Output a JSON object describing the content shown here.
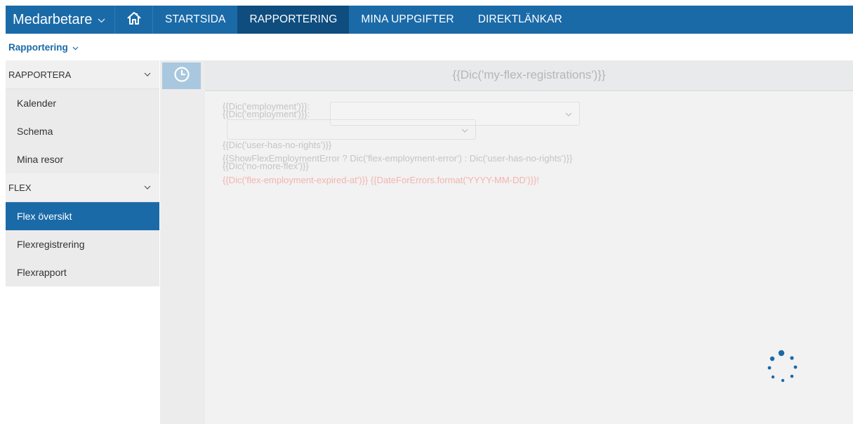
{
  "topbar": {
    "app_switcher": "Medarbetare",
    "nav": [
      {
        "label": "STARTSIDA",
        "active": false
      },
      {
        "label": "RAPPORTERING",
        "active": true
      },
      {
        "label": "MINA UPPGIFTER",
        "active": false
      },
      {
        "label": "DIREKTLÄNKAR",
        "active": false
      }
    ],
    "color": "#1a6aa8",
    "active_color": "#0f4d7e"
  },
  "subbar": {
    "breadcrumb": "Rapportering"
  },
  "sidebar": {
    "sections": [
      {
        "label": "RAPPORTERA",
        "items": [
          "Kalender",
          "Schema",
          "Mina resor"
        ]
      },
      {
        "label": "FLEX",
        "items": [
          "Flex översikt",
          "Flexregistrering",
          "Flexrapport"
        ]
      }
    ],
    "active_item": "Flex översikt"
  },
  "main": {
    "title": "{{Dic('my-flex-registrations')}}",
    "employment_label_1": "{{Dic('employment')}}:",
    "employment_label_2": "{{Dic('employment')}}:",
    "no_rights": "{{Dic('user-has-no-rights')}}",
    "error_line": "{{ShowFlexEmploymentError ? Dic('flex-employment-error') : Dic('user-has-no-rights')}}",
    "no_more_flex": "{{Dic('no-more-flex')}}",
    "expired": "{{Dic('flex-employment-expired-at')}} {{DateForErrors.format('YYYY-MM-DD')}}!"
  },
  "icons": {
    "app_chevron": "chevron-down-icon",
    "home": "home-icon",
    "clock": "clock-icon",
    "spinner": "loading-spinner-icon"
  }
}
